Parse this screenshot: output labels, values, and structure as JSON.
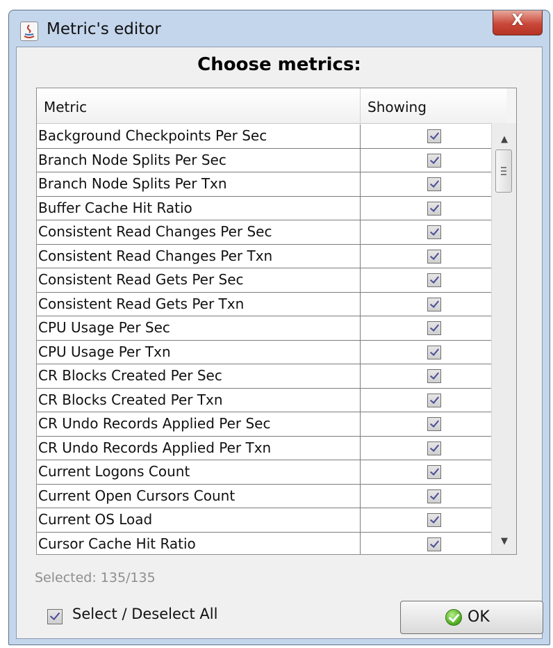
{
  "window": {
    "title": "Metric's editor",
    "close_label": "X"
  },
  "heading": "Choose metrics:",
  "table": {
    "columns": [
      "Metric",
      "Showing"
    ],
    "rows": [
      {
        "metric": "Background Checkpoints Per Sec",
        "showing": true
      },
      {
        "metric": "Branch Node Splits Per Sec",
        "showing": true
      },
      {
        "metric": "Branch Node Splits Per Txn",
        "showing": true
      },
      {
        "metric": "Buffer Cache Hit Ratio",
        "showing": true
      },
      {
        "metric": "Consistent Read Changes Per Sec",
        "showing": true
      },
      {
        "metric": "Consistent Read Changes Per Txn",
        "showing": true
      },
      {
        "metric": "Consistent Read Gets Per Sec",
        "showing": true
      },
      {
        "metric": "Consistent Read Gets Per Txn",
        "showing": true
      },
      {
        "metric": "CPU Usage Per Sec",
        "showing": true
      },
      {
        "metric": "CPU Usage Per Txn",
        "showing": true
      },
      {
        "metric": "CR Blocks Created Per Sec",
        "showing": true
      },
      {
        "metric": "CR Blocks Created Per Txn",
        "showing": true
      },
      {
        "metric": "CR Undo Records Applied Per Sec",
        "showing": true
      },
      {
        "metric": "CR Undo Records Applied Per Txn",
        "showing": true
      },
      {
        "metric": "Current Logons Count",
        "showing": true
      },
      {
        "metric": "Current Open Cursors Count",
        "showing": true
      },
      {
        "metric": "Current OS Load",
        "showing": true
      },
      {
        "metric": "Cursor Cache Hit Ratio",
        "showing": true
      }
    ]
  },
  "status": {
    "selected_text": "Selected: 135/135"
  },
  "footer": {
    "select_all_label": "Select / Deselect All",
    "select_all_checked": true,
    "ok_label": "OK"
  }
}
